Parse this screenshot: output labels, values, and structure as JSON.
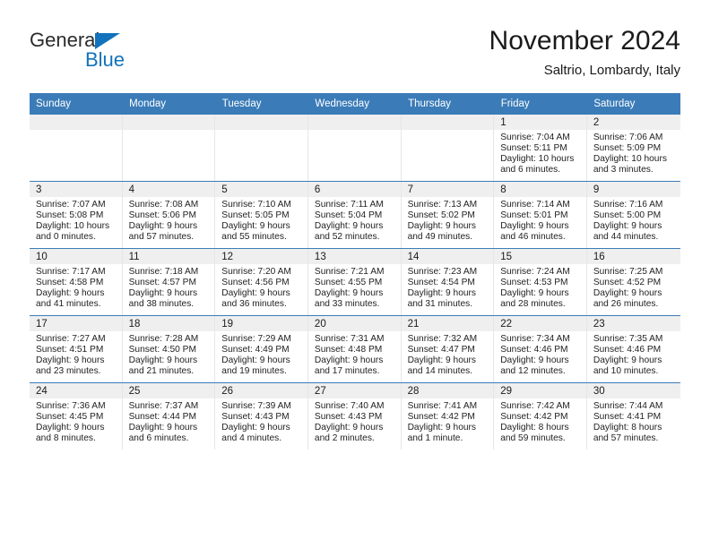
{
  "brand": {
    "name_top": "General",
    "name_bottom": "Blue",
    "accent_color": "#1272bb"
  },
  "header": {
    "title": "November 2024",
    "subtitle": "Saltrio, Lombardy, Italy"
  },
  "theme": {
    "header_row_bg": "#3b7cb8",
    "date_strip_bg": "#efefef",
    "text_color": "#1a1a1a"
  },
  "weekdays": [
    "Sunday",
    "Monday",
    "Tuesday",
    "Wednesday",
    "Thursday",
    "Friday",
    "Saturday"
  ],
  "weeks": [
    [
      {
        "day": "",
        "sunrise": "",
        "sunset": "",
        "daylight_1": "",
        "daylight_2": ""
      },
      {
        "day": "",
        "sunrise": "",
        "sunset": "",
        "daylight_1": "",
        "daylight_2": ""
      },
      {
        "day": "",
        "sunrise": "",
        "sunset": "",
        "daylight_1": "",
        "daylight_2": ""
      },
      {
        "day": "",
        "sunrise": "",
        "sunset": "",
        "daylight_1": "",
        "daylight_2": ""
      },
      {
        "day": "",
        "sunrise": "",
        "sunset": "",
        "daylight_1": "",
        "daylight_2": ""
      },
      {
        "day": "1",
        "sunrise": "Sunrise: 7:04 AM",
        "sunset": "Sunset: 5:11 PM",
        "daylight_1": "Daylight: 10 hours",
        "daylight_2": "and 6 minutes."
      },
      {
        "day": "2",
        "sunrise": "Sunrise: 7:06 AM",
        "sunset": "Sunset: 5:09 PM",
        "daylight_1": "Daylight: 10 hours",
        "daylight_2": "and 3 minutes."
      }
    ],
    [
      {
        "day": "3",
        "sunrise": "Sunrise: 7:07 AM",
        "sunset": "Sunset: 5:08 PM",
        "daylight_1": "Daylight: 10 hours",
        "daylight_2": "and 0 minutes."
      },
      {
        "day": "4",
        "sunrise": "Sunrise: 7:08 AM",
        "sunset": "Sunset: 5:06 PM",
        "daylight_1": "Daylight: 9 hours",
        "daylight_2": "and 57 minutes."
      },
      {
        "day": "5",
        "sunrise": "Sunrise: 7:10 AM",
        "sunset": "Sunset: 5:05 PM",
        "daylight_1": "Daylight: 9 hours",
        "daylight_2": "and 55 minutes."
      },
      {
        "day": "6",
        "sunrise": "Sunrise: 7:11 AM",
        "sunset": "Sunset: 5:04 PM",
        "daylight_1": "Daylight: 9 hours",
        "daylight_2": "and 52 minutes."
      },
      {
        "day": "7",
        "sunrise": "Sunrise: 7:13 AM",
        "sunset": "Sunset: 5:02 PM",
        "daylight_1": "Daylight: 9 hours",
        "daylight_2": "and 49 minutes."
      },
      {
        "day": "8",
        "sunrise": "Sunrise: 7:14 AM",
        "sunset": "Sunset: 5:01 PM",
        "daylight_1": "Daylight: 9 hours",
        "daylight_2": "and 46 minutes."
      },
      {
        "day": "9",
        "sunrise": "Sunrise: 7:16 AM",
        "sunset": "Sunset: 5:00 PM",
        "daylight_1": "Daylight: 9 hours",
        "daylight_2": "and 44 minutes."
      }
    ],
    [
      {
        "day": "10",
        "sunrise": "Sunrise: 7:17 AM",
        "sunset": "Sunset: 4:58 PM",
        "daylight_1": "Daylight: 9 hours",
        "daylight_2": "and 41 minutes."
      },
      {
        "day": "11",
        "sunrise": "Sunrise: 7:18 AM",
        "sunset": "Sunset: 4:57 PM",
        "daylight_1": "Daylight: 9 hours",
        "daylight_2": "and 38 minutes."
      },
      {
        "day": "12",
        "sunrise": "Sunrise: 7:20 AM",
        "sunset": "Sunset: 4:56 PM",
        "daylight_1": "Daylight: 9 hours",
        "daylight_2": "and 36 minutes."
      },
      {
        "day": "13",
        "sunrise": "Sunrise: 7:21 AM",
        "sunset": "Sunset: 4:55 PM",
        "daylight_1": "Daylight: 9 hours",
        "daylight_2": "and 33 minutes."
      },
      {
        "day": "14",
        "sunrise": "Sunrise: 7:23 AM",
        "sunset": "Sunset: 4:54 PM",
        "daylight_1": "Daylight: 9 hours",
        "daylight_2": "and 31 minutes."
      },
      {
        "day": "15",
        "sunrise": "Sunrise: 7:24 AM",
        "sunset": "Sunset: 4:53 PM",
        "daylight_1": "Daylight: 9 hours",
        "daylight_2": "and 28 minutes."
      },
      {
        "day": "16",
        "sunrise": "Sunrise: 7:25 AM",
        "sunset": "Sunset: 4:52 PM",
        "daylight_1": "Daylight: 9 hours",
        "daylight_2": "and 26 minutes."
      }
    ],
    [
      {
        "day": "17",
        "sunrise": "Sunrise: 7:27 AM",
        "sunset": "Sunset: 4:51 PM",
        "daylight_1": "Daylight: 9 hours",
        "daylight_2": "and 23 minutes."
      },
      {
        "day": "18",
        "sunrise": "Sunrise: 7:28 AM",
        "sunset": "Sunset: 4:50 PM",
        "daylight_1": "Daylight: 9 hours",
        "daylight_2": "and 21 minutes."
      },
      {
        "day": "19",
        "sunrise": "Sunrise: 7:29 AM",
        "sunset": "Sunset: 4:49 PM",
        "daylight_1": "Daylight: 9 hours",
        "daylight_2": "and 19 minutes."
      },
      {
        "day": "20",
        "sunrise": "Sunrise: 7:31 AM",
        "sunset": "Sunset: 4:48 PM",
        "daylight_1": "Daylight: 9 hours",
        "daylight_2": "and 17 minutes."
      },
      {
        "day": "21",
        "sunrise": "Sunrise: 7:32 AM",
        "sunset": "Sunset: 4:47 PM",
        "daylight_1": "Daylight: 9 hours",
        "daylight_2": "and 14 minutes."
      },
      {
        "day": "22",
        "sunrise": "Sunrise: 7:34 AM",
        "sunset": "Sunset: 4:46 PM",
        "daylight_1": "Daylight: 9 hours",
        "daylight_2": "and 12 minutes."
      },
      {
        "day": "23",
        "sunrise": "Sunrise: 7:35 AM",
        "sunset": "Sunset: 4:46 PM",
        "daylight_1": "Daylight: 9 hours",
        "daylight_2": "and 10 minutes."
      }
    ],
    [
      {
        "day": "24",
        "sunrise": "Sunrise: 7:36 AM",
        "sunset": "Sunset: 4:45 PM",
        "daylight_1": "Daylight: 9 hours",
        "daylight_2": "and 8 minutes."
      },
      {
        "day": "25",
        "sunrise": "Sunrise: 7:37 AM",
        "sunset": "Sunset: 4:44 PM",
        "daylight_1": "Daylight: 9 hours",
        "daylight_2": "and 6 minutes."
      },
      {
        "day": "26",
        "sunrise": "Sunrise: 7:39 AM",
        "sunset": "Sunset: 4:43 PM",
        "daylight_1": "Daylight: 9 hours",
        "daylight_2": "and 4 minutes."
      },
      {
        "day": "27",
        "sunrise": "Sunrise: 7:40 AM",
        "sunset": "Sunset: 4:43 PM",
        "daylight_1": "Daylight: 9 hours",
        "daylight_2": "and 2 minutes."
      },
      {
        "day": "28",
        "sunrise": "Sunrise: 7:41 AM",
        "sunset": "Sunset: 4:42 PM",
        "daylight_1": "Daylight: 9 hours",
        "daylight_2": "and 1 minute."
      },
      {
        "day": "29",
        "sunrise": "Sunrise: 7:42 AM",
        "sunset": "Sunset: 4:42 PM",
        "daylight_1": "Daylight: 8 hours",
        "daylight_2": "and 59 minutes."
      },
      {
        "day": "30",
        "sunrise": "Sunrise: 7:44 AM",
        "sunset": "Sunset: 4:41 PM",
        "daylight_1": "Daylight: 8 hours",
        "daylight_2": "and 57 minutes."
      }
    ]
  ]
}
